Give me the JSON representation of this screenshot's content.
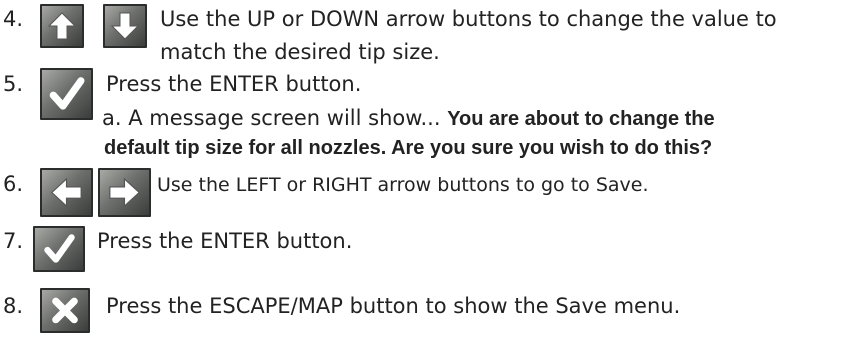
{
  "steps": [
    {
      "number": "4.",
      "line1_pre": "Use the ",
      "key1": "UP",
      "line1_mid": " or ",
      "key2": "DOWN",
      "line1_post": " arrow buttons to change the value to",
      "line2": "match the desired tip size."
    },
    {
      "number": "5.",
      "pre": "Press the ",
      "key": "ENTER",
      "post": " button.",
      "sub_pre": "a. A message screen will show... ",
      "sub_bold1": "You are about to change the",
      "sub_bold2": "default tip size for all nozzles. Are you sure you wish to do this?"
    },
    {
      "number": "6.",
      "pre": "Use the ",
      "key1": "LEFT",
      "mid": " or ",
      "key2": "RIGHT",
      "post": " arrow buttons to go to Save."
    },
    {
      "number": "7.",
      "pre": "Press the ",
      "key": "ENTER",
      "post": " button."
    },
    {
      "number": "8.",
      "pre": "Press the ",
      "key": "ESCAPE/MAP",
      "post": " button to show the Save menu."
    }
  ],
  "icons": {
    "up": "up-arrow-icon",
    "down": "down-arrow-icon",
    "enter": "checkmark-icon",
    "left": "left-arrow-icon",
    "right": "right-arrow-icon",
    "escape": "x-icon"
  }
}
